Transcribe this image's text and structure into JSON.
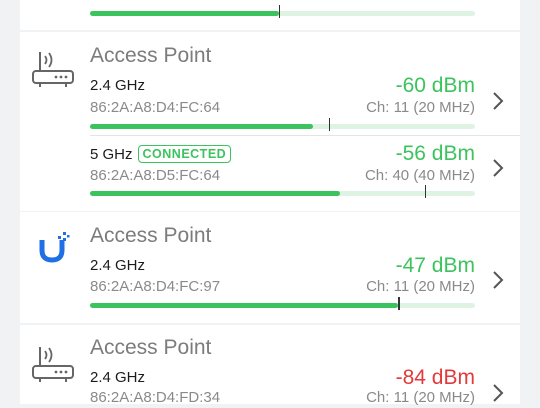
{
  "top_row": {
    "signal_fill": 0.49,
    "marker": 0.49
  },
  "groups": [
    {
      "title": "Access Point",
      "icon": "router-icon",
      "entries": [
        {
          "band": "2.4 GHz",
          "badge": "",
          "mac": "86:2A:A8:D4:FC:64",
          "signal": "-60 dBm",
          "channel": "Ch: 11 (20 MHz)",
          "status_color": "#3cc35e",
          "fill": 0.58,
          "marker": 0.62
        },
        {
          "band": "5 GHz",
          "badge": "CONNECTED",
          "mac": "86:2A:A8:D5:FC:64",
          "signal": "-56 dBm",
          "channel": "Ch: 40 (40 MHz)",
          "status_color": "#3cc35e",
          "fill": 0.65,
          "marker": 0.87
        }
      ]
    },
    {
      "title": "Access Point",
      "icon": "ubiquiti-logo-icon",
      "entries": [
        {
          "band": "2.4 GHz",
          "badge": "",
          "mac": "86:2A:A8:D4:FC:97",
          "signal": "-47 dBm",
          "channel": "Ch: 11 (20 MHz)",
          "status_color": "#3cc35e",
          "fill": 0.8,
          "marker": 0.8
        }
      ]
    },
    {
      "title": "Access Point",
      "icon": "router-icon",
      "entries": [
        {
          "band": "2.4 GHz",
          "badge": "",
          "mac": "86:2A:A8:D4:FD:34",
          "signal": "-84 dBm",
          "channel": "Ch: 11 (20 MHz)",
          "status_color": "#e23a3a"
        }
      ]
    }
  ]
}
